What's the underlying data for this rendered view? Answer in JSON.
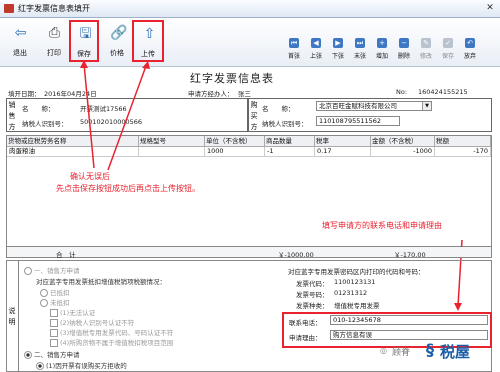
{
  "window": {
    "title": "红字发票信息表填开",
    "close": "✕"
  },
  "toolbar": {
    "buttons": [
      {
        "label": "退出",
        "icon": "exit-icon"
      },
      {
        "label": "打印",
        "icon": "print-icon"
      },
      {
        "label": "保存",
        "icon": "save-icon"
      },
      {
        "label": "价格",
        "icon": "price-icon"
      },
      {
        "label": "上传",
        "icon": "upload-icon"
      }
    ],
    "nav": [
      {
        "label": "首张",
        "glyph": "⏮"
      },
      {
        "label": "上张",
        "glyph": "◀"
      },
      {
        "label": "下张",
        "glyph": "▶"
      },
      {
        "label": "末张",
        "glyph": "⏭"
      },
      {
        "label": "增加",
        "glyph": "+"
      },
      {
        "label": "删除",
        "glyph": "−"
      },
      {
        "label": "修改",
        "glyph": "✎",
        "disabled": true
      },
      {
        "label": "保存",
        "glyph": "✓",
        "disabled": true
      },
      {
        "label": "放弃",
        "glyph": "↶"
      }
    ]
  },
  "form": {
    "title": "红字发票信息表",
    "fill_date_label": "填开日期：",
    "fill_date": "2016年04月24日",
    "applicant_label": "申请方经办人：",
    "applicant": "张三",
    "no_label": "No:",
    "no": "160424155215"
  },
  "seller": {
    "vlabel": "销售方",
    "name_label": "名　　称：",
    "name": "开票测试17566",
    "tax_label": "纳税人识别号：",
    "tax_id": "500102010000566"
  },
  "buyer": {
    "vlabel": "购买方",
    "name_label": "名　　称：",
    "name": "北京百旺金赋科技有限公司",
    "tax_label": "纳税人识别号：",
    "tax_id": "110108795511562"
  },
  "grid": {
    "headers": [
      "货物或应税劳务名称",
      "规格型号",
      "单位（不含税）",
      "商品数量",
      "税率",
      "金额（不含税）",
      "税额"
    ],
    "row": [
      "肉蛋粮油",
      "",
      "1000",
      "-1",
      "0.17",
      "-1000",
      "-170"
    ],
    "totals_label": "合　计",
    "total_amount": "￥-1000.00",
    "total_tax": "￥-170.00"
  },
  "annotations": {
    "confirm_line1": "确认无误后",
    "confirm_line2": "先点击保存按钮成功后再点击上传按钮。",
    "contact_hint": "填写申请方的联系电话和申请理由"
  },
  "notes": {
    "vlabel": "说明",
    "seller_apply": "一、销售方申请",
    "seller_q": "对应蓝字专用发票抵扣增值税销项税额情况：",
    "opt_certified": "已抵扣",
    "opt_uncertified": "未抵扣",
    "opt_1": "(1)无法认证",
    "opt_2": "(2)纳税人识别号认证不符",
    "opt_3": "(3)增值税专用发票代码、号码认证不符",
    "opt_4": "(4)所购货物不属于增值税扣税项目范围",
    "buyer_apply": "二、销售方申请",
    "opt_b1": "(1)因开票有误购买方拒收的",
    "right_header": "对应蓝字专用发票密码区内打印的代码和号码：",
    "code_label": "发票代码：",
    "code": "1100123131",
    "num_label": "发票号码：",
    "num": "01231312",
    "tax_type_label": "发票种类：",
    "tax_type": "增值税专用发票",
    "phone_label": "联系电话：",
    "phone": "010-12345678",
    "reason_label": "申请理由：",
    "reason": "购方信息有误"
  },
  "watermark": {
    "prefix": "顾脊",
    "brand": "税屋"
  },
  "colors": {
    "accent": "#e8232f",
    "brand_blue": "#1a5ea8"
  }
}
